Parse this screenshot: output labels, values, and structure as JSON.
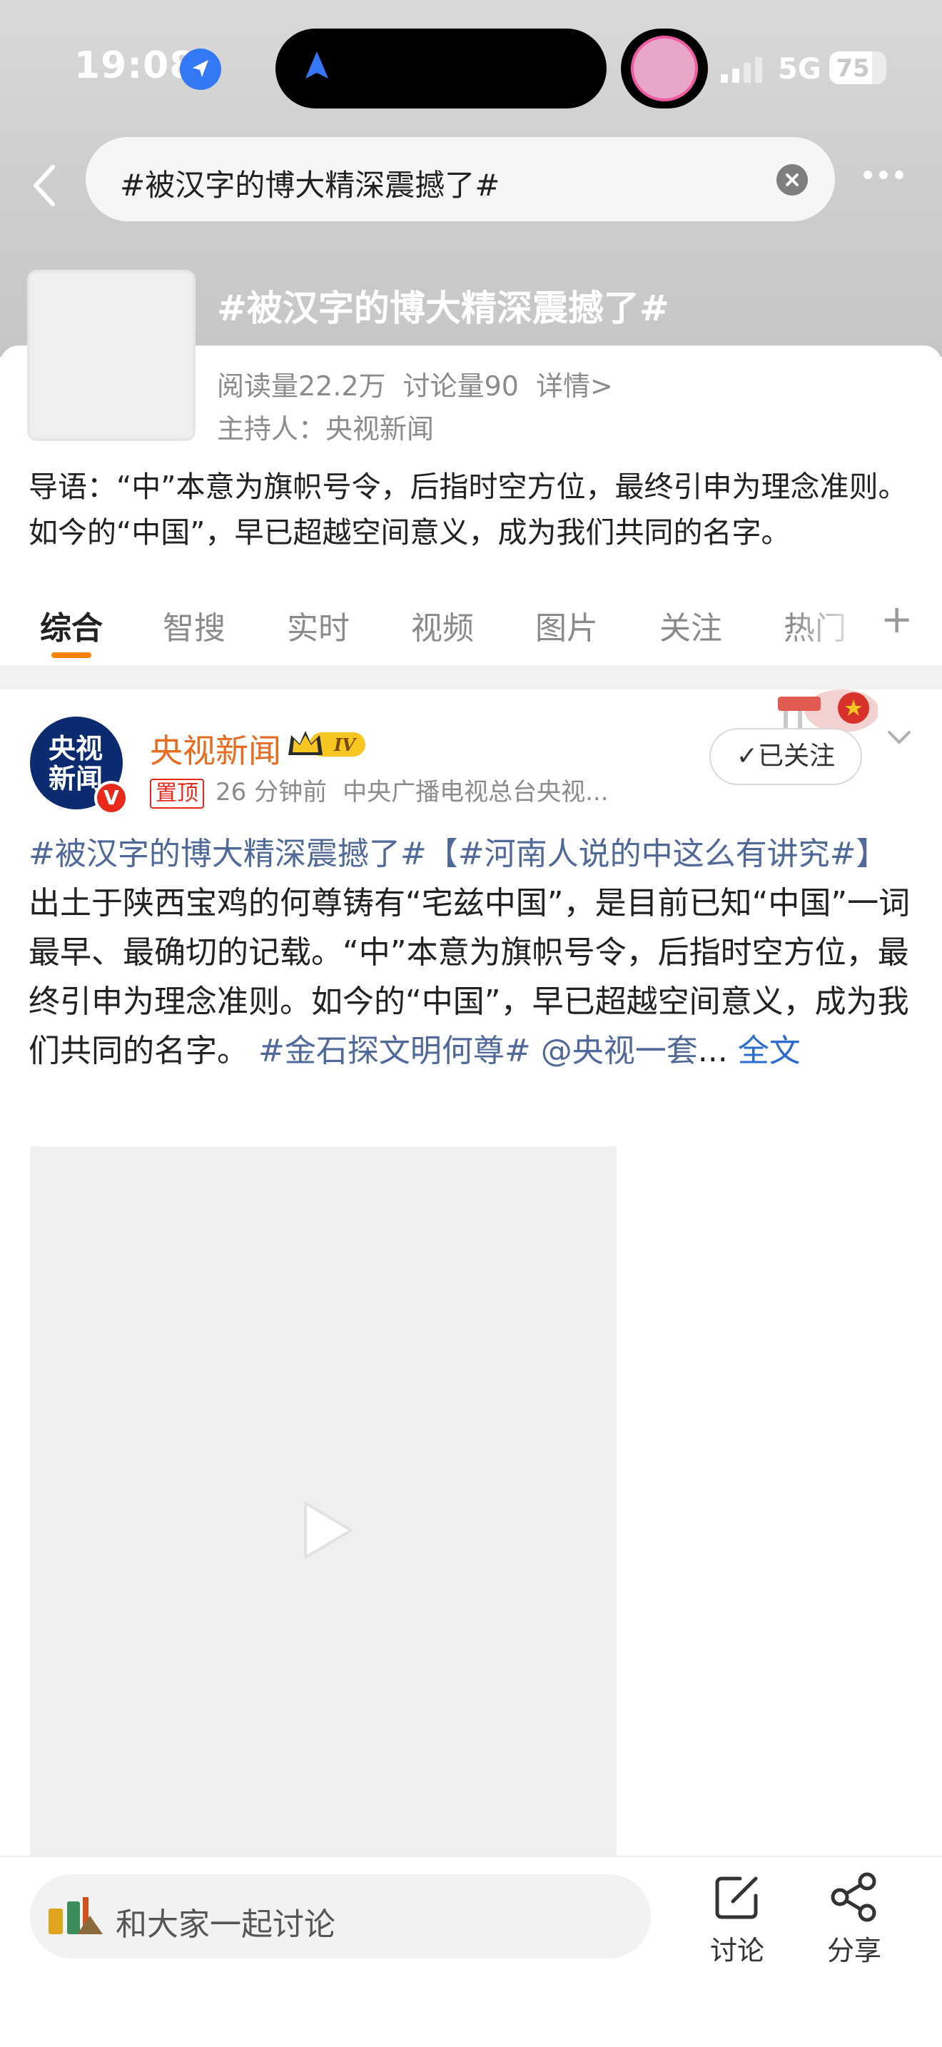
{
  "status_bar": {
    "time": "19:08",
    "network": "5G",
    "battery": "75",
    "battery_level": 0.75
  },
  "search": {
    "query": "#被汉字的博大精深震撼了#"
  },
  "topic": {
    "title": "#被汉字的博大精深震撼了#",
    "reads": "阅读量22.2万",
    "discussions": "讨论量90",
    "details_link": "详情>",
    "host": "主持人：央视新闻",
    "intro": "导语：“中”本意为旗帜号令，后指时空方位，最终引申为理念准则。如今的“中国”，早已超越空间意义，成为我们共同的名字。"
  },
  "tabs": [
    {
      "label": "综合",
      "active": true
    },
    {
      "label": "智搜"
    },
    {
      "label": "实时"
    },
    {
      "label": "视频"
    },
    {
      "label": "图片"
    },
    {
      "label": "关注"
    },
    {
      "label": "热门"
    }
  ],
  "post": {
    "avatar_text": "央视新闻",
    "verified_mark": "V",
    "author": "央视新闻",
    "vip_level": "IV",
    "pin_label": "置顶",
    "time": "26 分钟前",
    "source": "中央广播电视总台央视...",
    "follow_label": "✓已关注",
    "text": {
      "tag1": "#被汉字的博大精深震撼了#",
      "tag2": "【#河南人说的中这么有讲究#】",
      "body": "出土于陕西宝鸡的何尊铸有“宅兹中国”，是目前已知“中国”一词最早、最确切的记载。“中”本意为旗帜号令，后指时空方位，最终引申为理念准则。如今的“中国”，早已超越空间意义，成为我们共同的名字。",
      "tag3": "#金石探文明何尊#",
      "mention": "@央视一套",
      "ellipsis": "...",
      "more": "全文"
    }
  },
  "bottom_bar": {
    "comment_placeholder": "和大家一起讨论",
    "discuss_label": "讨论",
    "share_label": "分享"
  },
  "colors": {
    "accent_orange": "#ff8200",
    "author_orange": "#e86b1f",
    "tag_blue": "#50699a",
    "link_blue": "#2c6bd1"
  },
  "icons": [
    "location-arrow-icon",
    "navigation-icon",
    "signal-icon",
    "battery-icon",
    "back-icon",
    "clear-icon",
    "more-icon",
    "crown-icon",
    "chevron-down-icon",
    "play-icon",
    "compose-icon",
    "share-icon",
    "plus-icon"
  ]
}
